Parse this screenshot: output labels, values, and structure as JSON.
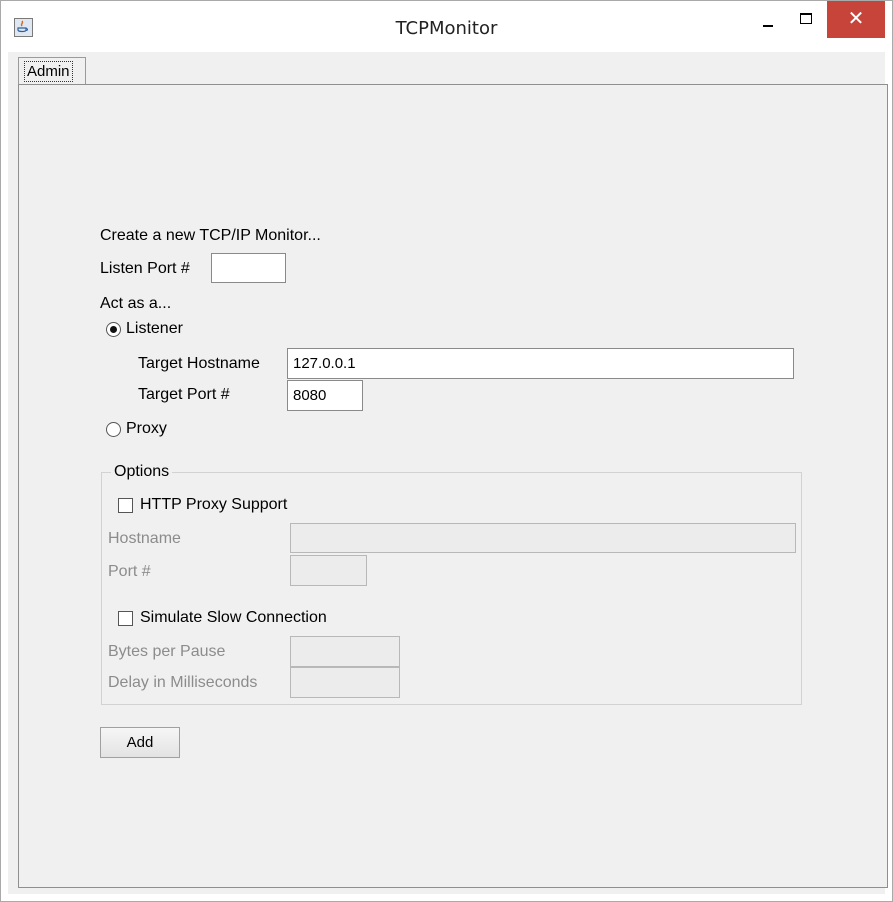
{
  "window": {
    "title": "TCPMonitor",
    "close_glyph": "✕",
    "icons": [
      "java-app-icon",
      "minimize-icon",
      "maximize-icon",
      "close-icon"
    ]
  },
  "tabs": [
    {
      "label": "Admin",
      "selected": true
    }
  ],
  "form": {
    "heading": "Create a new TCP/IP Monitor...",
    "listen_port_label": "Listen Port #",
    "listen_port_value": "",
    "act_as_label": "Act as a...",
    "listener_label": "Listener",
    "listener_selected": true,
    "target_hostname_label": "Target Hostname",
    "target_hostname_value": "127.0.0.1",
    "target_port_label": "Target Port #",
    "target_port_value": "8080",
    "proxy_label": "Proxy",
    "proxy_selected": false
  },
  "options": {
    "legend": "Options",
    "http_proxy_label": "HTTP Proxy Support",
    "http_proxy_checked": false,
    "hostname_label": "Hostname",
    "hostname_value": "",
    "port_label": "Port #",
    "port_value": "",
    "slow_connection_label": "Simulate Slow Connection",
    "slow_connection_checked": false,
    "bytes_per_pause_label": "Bytes per Pause",
    "bytes_per_pause_value": "",
    "delay_label": "Delay in Milliseconds",
    "delay_value": ""
  },
  "add_button_label": "Add",
  "colors": {
    "close_button": "#c7443a",
    "panel_background": "#f0f0f0"
  }
}
